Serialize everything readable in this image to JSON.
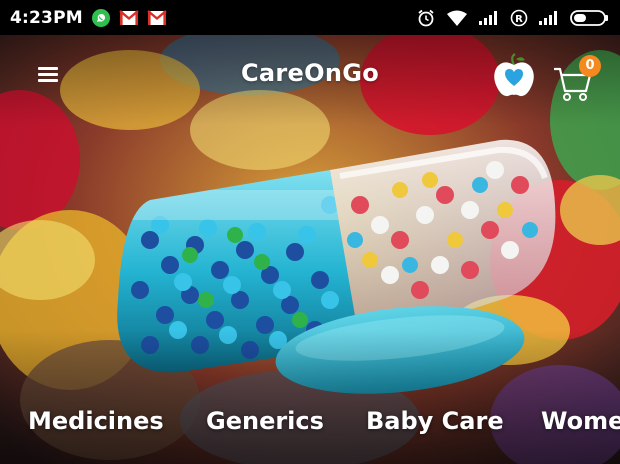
{
  "status_bar": {
    "time": "4:23PM",
    "left_icons": [
      "whatsapp-icon",
      "gmail-icon",
      "gmail-icon"
    ],
    "right_icons": [
      "alarm-icon",
      "wifi-icon",
      "signal-icon",
      "roaming-icon",
      "signal-icon",
      "battery-icon"
    ]
  },
  "app_bar": {
    "title": "CareOnGo",
    "menu_icon": "hamburger-menu-icon",
    "health_icon": "apple-heart-icon",
    "cart_icon": "shopping-cart-icon",
    "cart_count": "0"
  },
  "categories": [
    {
      "label": "Medicines"
    },
    {
      "label": "Generics"
    },
    {
      "label": "Baby Care"
    },
    {
      "label": "Wome"
    }
  ],
  "colors": {
    "status_bar": "#000000",
    "accent": "#f5891f",
    "heart": "#2aa3e0",
    "text": "#ffffff"
  }
}
